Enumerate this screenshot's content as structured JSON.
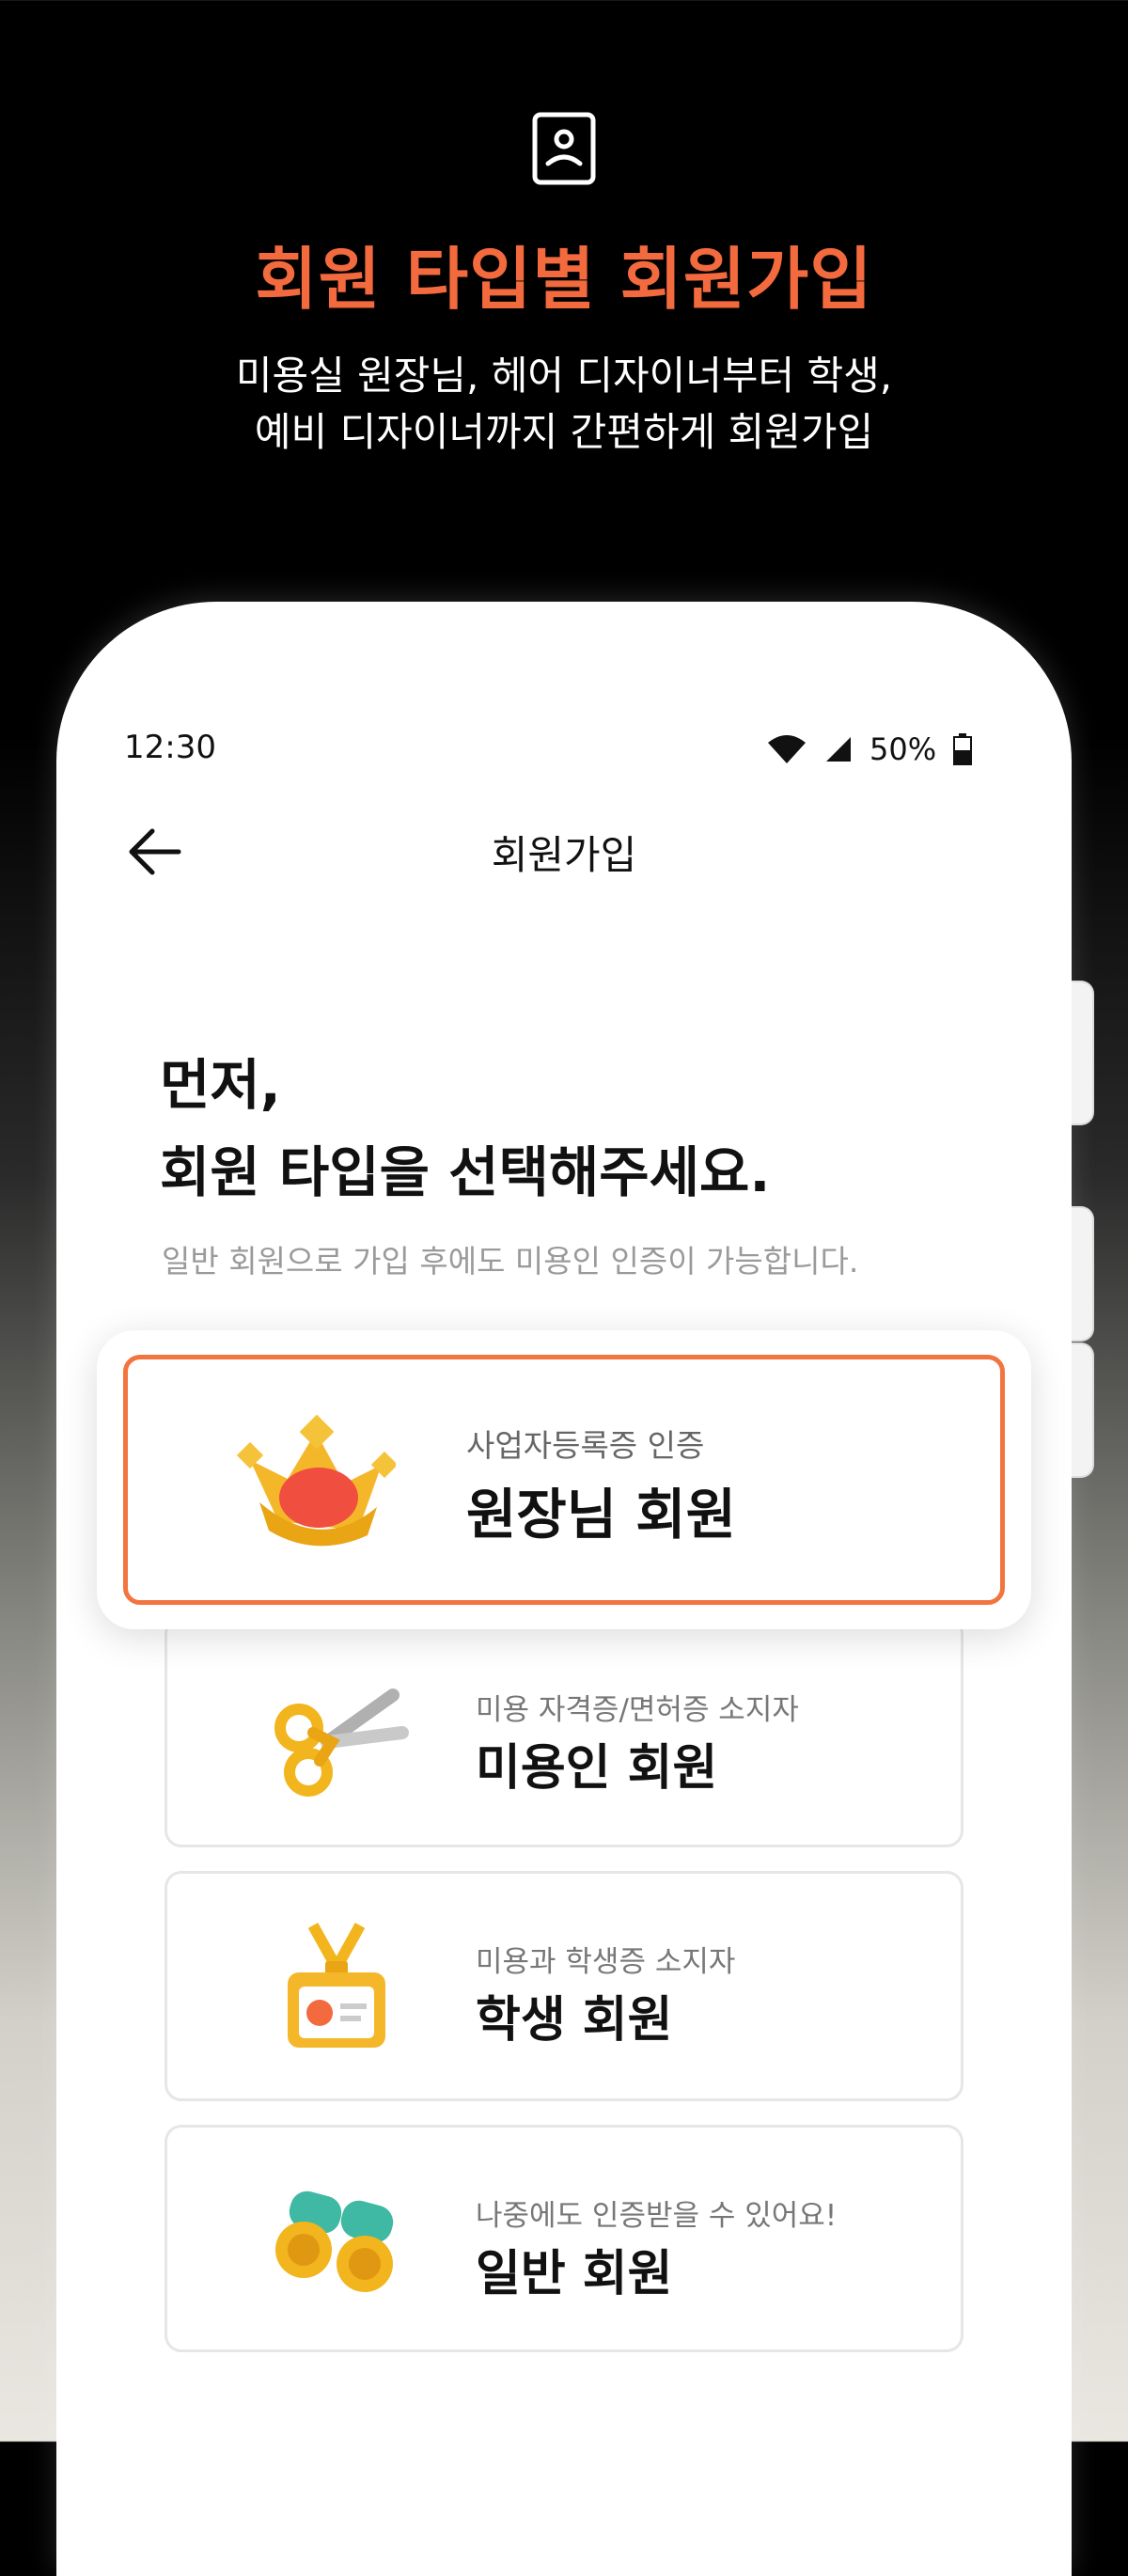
{
  "hero": {
    "icon": "profile-card-icon",
    "title": "회원 타입별 회원가입",
    "subtitle_line1": "미용실 원장님, 헤어 디자이너부터 학생,",
    "subtitle_line2": "예비 디자이너까지 간편하게 회원가입"
  },
  "status_bar": {
    "time": "12:30",
    "battery": "50%"
  },
  "nav": {
    "back_icon": "back-arrow-icon",
    "title": "회원가입"
  },
  "main": {
    "heading_line1": "먼저,",
    "heading_line2": "회원 타입을 선택해주세요.",
    "subtext": "일반 회원으로 가입 후에도 미용인 인증이 가능합니다."
  },
  "member_types": [
    {
      "caption": "사업자등록증 인증",
      "title": "원장님 회원",
      "icon": "crown-icon",
      "selected": true
    },
    {
      "caption": "미용 자격증/면허증 소지자",
      "title": "미용인 회원",
      "icon": "scissors-icon",
      "selected": false
    },
    {
      "caption": "미용과 학생증 소지자",
      "title": "학생 회원",
      "icon": "id-badge-icon",
      "selected": false
    },
    {
      "caption": "나중에도 인증받을 수 있어요!",
      "title": "일반 회원",
      "icon": "binoculars-icon",
      "selected": false
    }
  ],
  "colors": {
    "accent": "#f26a3d",
    "selected_border": "#f2753f",
    "background": "#000000"
  }
}
